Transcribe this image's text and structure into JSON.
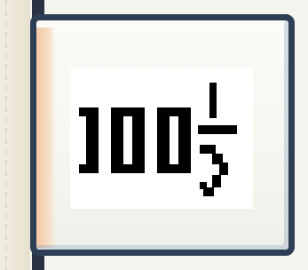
{
  "toolbar": {
    "zoom_button": {
      "icon": "zoom-100-percent-icon",
      "zoom_level": "100%"
    }
  },
  "colors": {
    "button_border": "#2e3f55",
    "button_face": "#f6f6f1",
    "glyph": "#000000",
    "edge_highlight": "#f3c9a6"
  }
}
